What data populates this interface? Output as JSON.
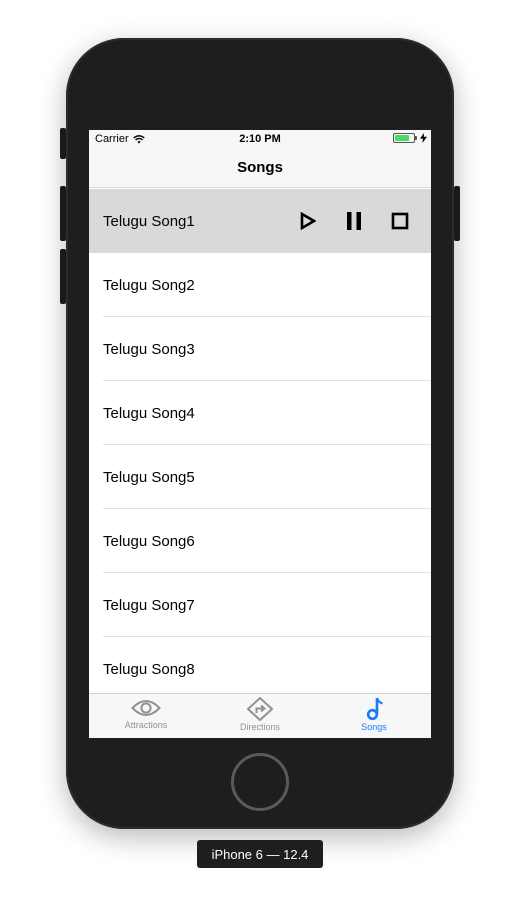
{
  "status_bar": {
    "carrier": "Carrier",
    "time": "2:10 PM"
  },
  "nav": {
    "title": "Songs"
  },
  "songs": [
    {
      "title": "Telugu Song1",
      "selected": true
    },
    {
      "title": "Telugu Song2"
    },
    {
      "title": "Telugu Song3"
    },
    {
      "title": "Telugu Song4"
    },
    {
      "title": "Telugu Song5"
    },
    {
      "title": "Telugu Song6"
    },
    {
      "title": "Telugu Song7"
    },
    {
      "title": "Telugu Song8"
    }
  ],
  "controls": {
    "icons": [
      "play-icon",
      "pause-icon",
      "stop-icon"
    ]
  },
  "tabs": [
    {
      "label": "Attractions",
      "icon": "eye-icon",
      "active": false
    },
    {
      "label": "Directions",
      "icon": "directions-icon",
      "active": false
    },
    {
      "label": "Songs",
      "icon": "music-note-icon",
      "active": true
    }
  ],
  "colors": {
    "accent": "#1a7cf5",
    "selected_row": "#d9d9d9",
    "battery": "#4cd964",
    "inactive_tab": "#929292"
  },
  "device": {
    "label": "iPhone 6 — 12.4"
  }
}
